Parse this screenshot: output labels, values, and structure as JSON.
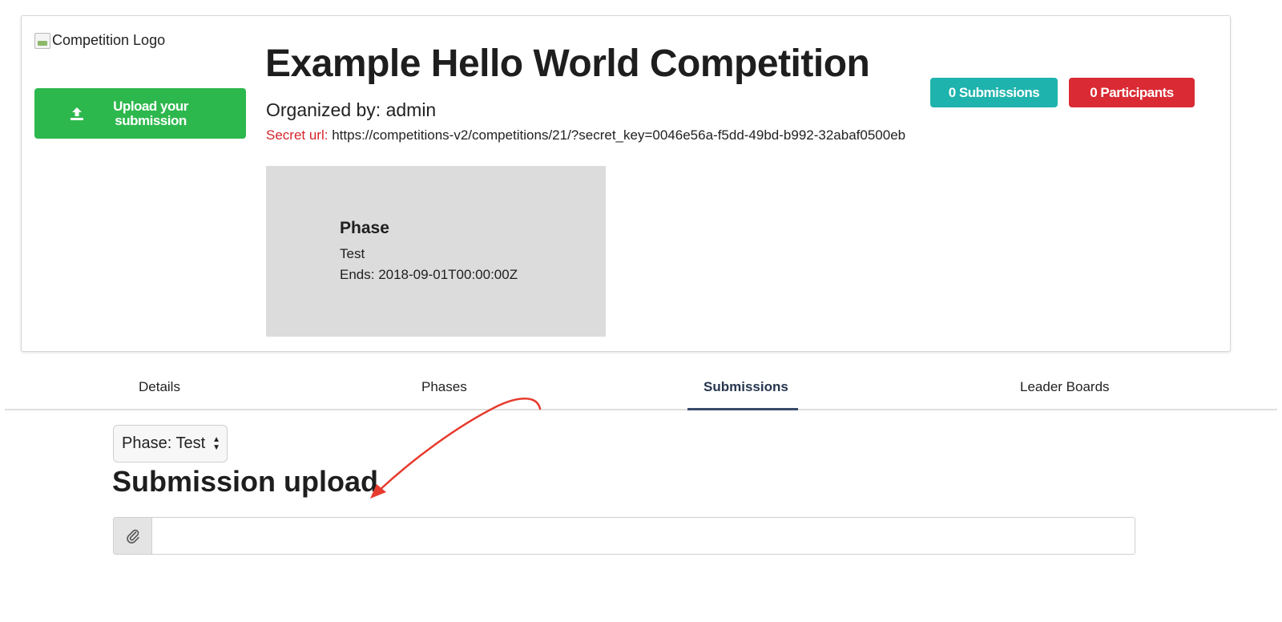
{
  "header": {
    "logo_alt": "Competition Logo",
    "upload_button_label": "Upload your\nsubmission",
    "title": "Example Hello World Competition",
    "organizer": "Organized by: admin",
    "secret_url_label": "Secret url:",
    "secret_url_value": "https://competitions-v2/competitions/21/?secret_key=0046e56a-f5dd-49bd-b992-32abaf0500eb",
    "submissions_badge": "0 Submissions",
    "participants_badge": "0 Participants",
    "submissions_color": "#1fb3ad",
    "participants_color": "#da2a33",
    "upload_color": "#2db84d"
  },
  "phase_card": {
    "heading": "Phase",
    "name": "Test",
    "ends": "Ends: 2018-09-01T00:00:00Z"
  },
  "tabs": [
    {
      "label": "Details",
      "active": false
    },
    {
      "label": "Phases",
      "active": false
    },
    {
      "label": "Submissions",
      "active": true
    },
    {
      "label": "Leader Boards",
      "active": false
    }
  ],
  "submissions_panel": {
    "phase_select_value": "Phase: Test",
    "heading": "Submission upload",
    "file_input_value": ""
  },
  "icons": {
    "upload": "upload-icon",
    "clip": "paperclip-icon",
    "select_chevron": "select-arrows-icon"
  }
}
